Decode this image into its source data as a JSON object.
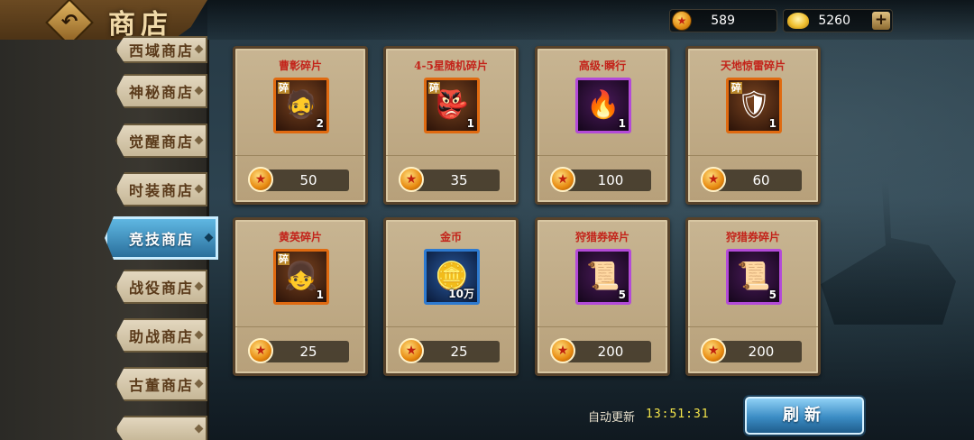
{
  "header": {
    "title": "商店",
    "coins": "589",
    "ingots": "5260"
  },
  "sidebar": {
    "tabs": [
      {
        "label": "西域商店"
      },
      {
        "label": "神秘商店"
      },
      {
        "label": "觉醒商店"
      },
      {
        "label": "时装商店"
      },
      {
        "label": "竞技商店",
        "active": true
      },
      {
        "label": "战役商店"
      },
      {
        "label": "助战商店"
      },
      {
        "label": "古董商店"
      }
    ]
  },
  "items": [
    {
      "name": "曹彰碎片",
      "qty": "2",
      "shard": "碎",
      "price": "50",
      "art": "🧔",
      "frame": "orange"
    },
    {
      "name": "4-5星随机碎片",
      "qty": "1",
      "shard": "碎",
      "price": "35",
      "art": "👺",
      "frame": "orange"
    },
    {
      "name": "高级·瞬行",
      "qty": "1",
      "shard": "",
      "price": "100",
      "art": "🔥",
      "frame": "purple"
    },
    {
      "name": "天地惊雷碎片",
      "qty": "1",
      "shard": "碎",
      "price": "60",
      "art": "🛡",
      "frame": "orange"
    },
    {
      "name": "黄英碎片",
      "qty": "1",
      "shard": "碎",
      "price": "25",
      "art": "👧",
      "frame": "orange"
    },
    {
      "name": "金币",
      "qty": "10万",
      "shard": "",
      "price": "25",
      "art": "🪙",
      "frame": "blue"
    },
    {
      "name": "狩猎券碎片",
      "qty": "5",
      "shard": "",
      "price": "200",
      "art": "📜",
      "frame": "purple"
    },
    {
      "name": "狩猎券碎片",
      "qty": "5",
      "shard": "",
      "price": "200",
      "art": "📜",
      "frame": "purple"
    }
  ],
  "footer": {
    "refresh_label": "自动更新",
    "refresh_time": "13:51:31",
    "refresh_button": "刷新"
  },
  "colors": {
    "accent_blue": "#3b8cc4",
    "price_text": "#ffffff",
    "item_name": "#c3231a",
    "timer": "#f3e44a"
  }
}
